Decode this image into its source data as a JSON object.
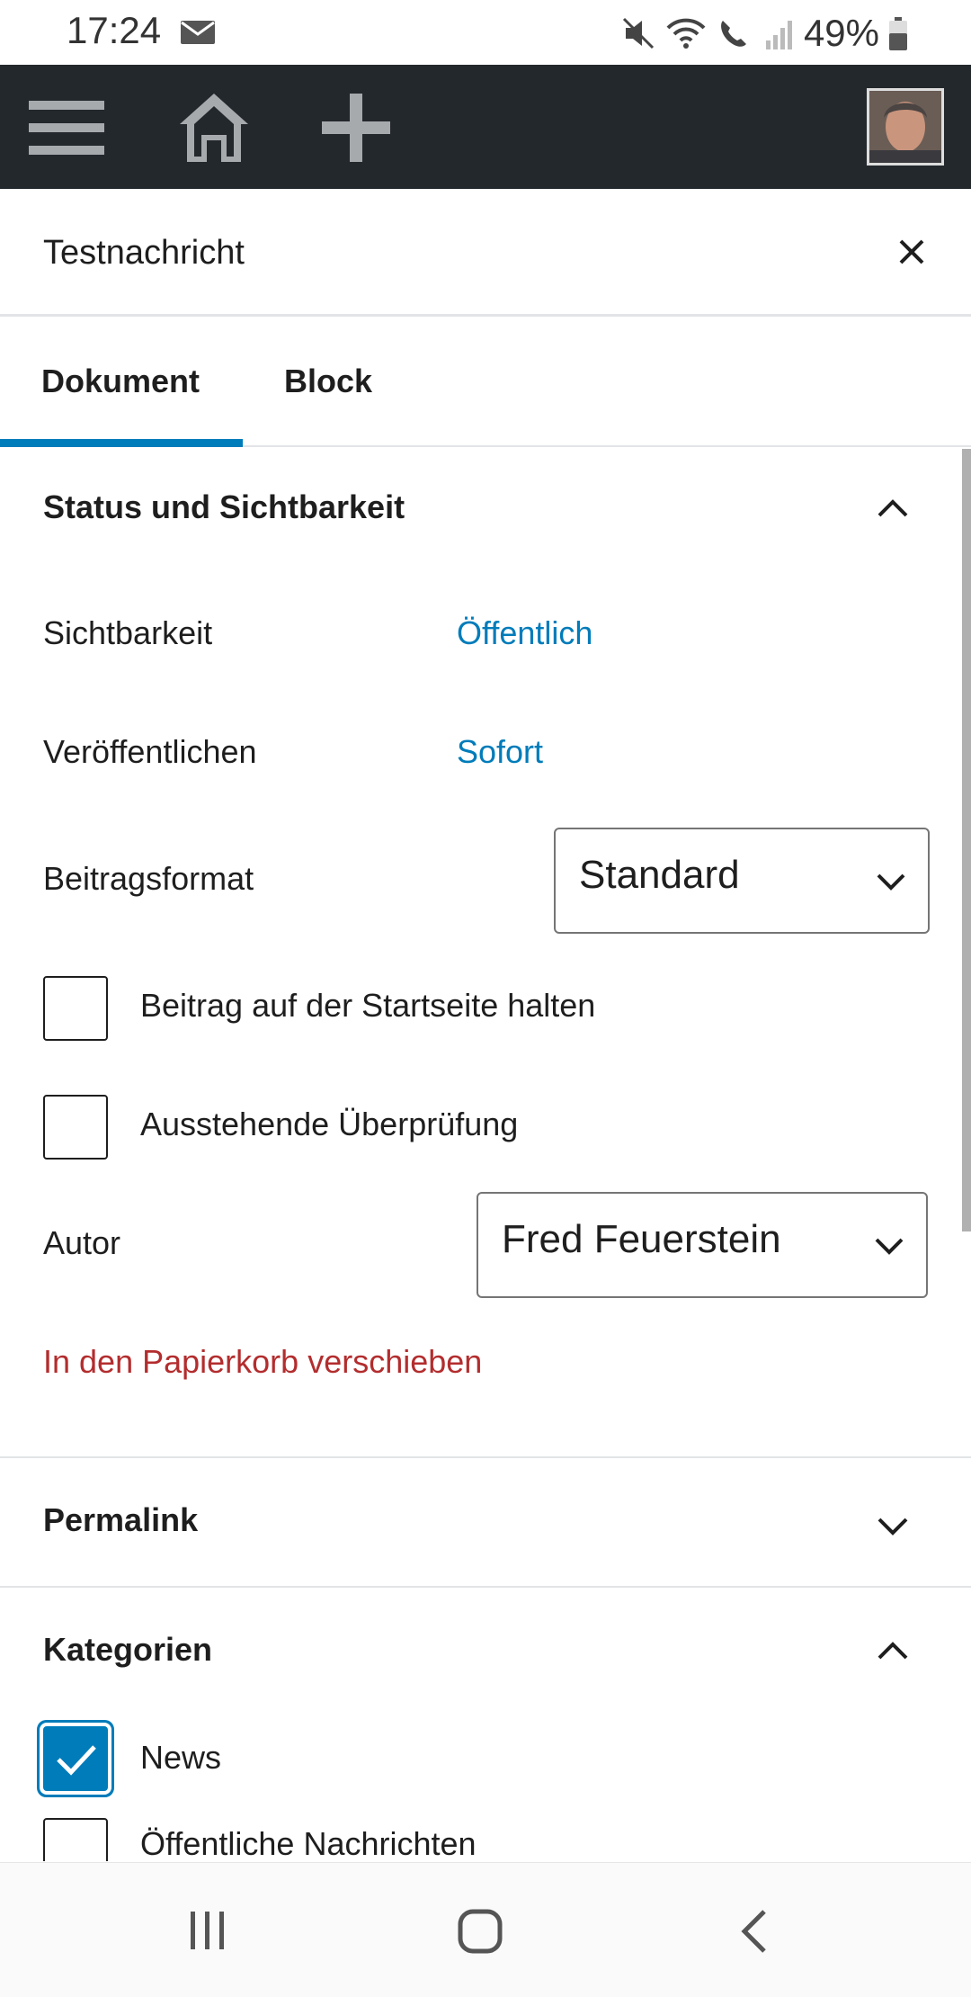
{
  "status_bar": {
    "time": "17:24",
    "battery": "49%"
  },
  "admin_bar": {
    "icons": [
      "menu-icon",
      "home-icon",
      "plus-icon",
      "avatar"
    ]
  },
  "sheet": {
    "title": "Testnachricht"
  },
  "tabs": [
    {
      "label": "Dokument",
      "active": true
    },
    {
      "label": "Block",
      "active": false
    }
  ],
  "status_section": {
    "title": "Status und Sichtbarkeit",
    "visibility_label": "Sichtbarkeit",
    "visibility_value": "Öffentlich",
    "publish_label": "Veröffentlichen",
    "publish_value": "Sofort",
    "format_label": "Beitragsformat",
    "format_value": "Standard",
    "sticky_label": "Beitrag auf der Startseite halten",
    "pending_label": "Ausstehende Überprüfung",
    "author_label": "Autor",
    "author_value": "Fred Feuerstein",
    "trash_label": "In den Papierkorb verschieben"
  },
  "permalink_section": {
    "title": "Permalink"
  },
  "categories_section": {
    "title": "Kategorien",
    "items": [
      {
        "label": "News",
        "checked": true
      },
      {
        "label": "Öffentliche Nachrichten",
        "checked": false
      }
    ]
  },
  "colors": {
    "accent": "#007cba",
    "admin_bar": "#23282d",
    "destructive": "#b32d2e"
  }
}
